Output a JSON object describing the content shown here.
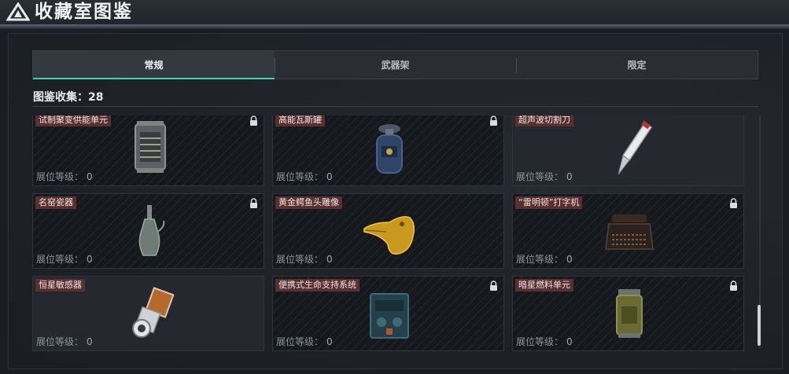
{
  "window": {
    "title": "收藏室图鉴"
  },
  "tabs": [
    {
      "label": "常规",
      "active": true
    },
    {
      "label": "武器架",
      "active": false
    },
    {
      "label": "限定",
      "active": false
    }
  ],
  "collection": {
    "label": "图鉴收集：",
    "count": "28"
  },
  "level_label": "展位等级：",
  "colors": {
    "accent": "#3fd1b3",
    "name_tag": "#5a2f30"
  },
  "items": [
    {
      "name": "试制聚变供能单元",
      "level": "0",
      "locked": true,
      "icon": "fusion-cell-icon"
    },
    {
      "name": "高能瓦斯罐",
      "level": "0",
      "locked": true,
      "icon": "gas-canister-icon"
    },
    {
      "name": "超声波切割刀",
      "level": "0",
      "locked": false,
      "icon": "ultrasonic-knife-icon"
    },
    {
      "name": "名窑瓷器",
      "level": "0",
      "locked": true,
      "icon": "porcelain-vase-icon"
    },
    {
      "name": "黄金鳄鱼头雕像",
      "level": "0",
      "locked": false,
      "icon": "golden-crocodile-icon"
    },
    {
      "name": "“雷明顿”打字机",
      "level": "0",
      "locked": true,
      "icon": "typewriter-icon"
    },
    {
      "name": "恒星敏感器",
      "level": "0",
      "locked": false,
      "icon": "star-sensor-icon"
    },
    {
      "name": "便携式生命支持系统",
      "level": "0",
      "locked": true,
      "icon": "life-support-icon"
    },
    {
      "name": "暗星燃料单元",
      "level": "0",
      "locked": true,
      "icon": "fuel-cell-icon"
    }
  ]
}
